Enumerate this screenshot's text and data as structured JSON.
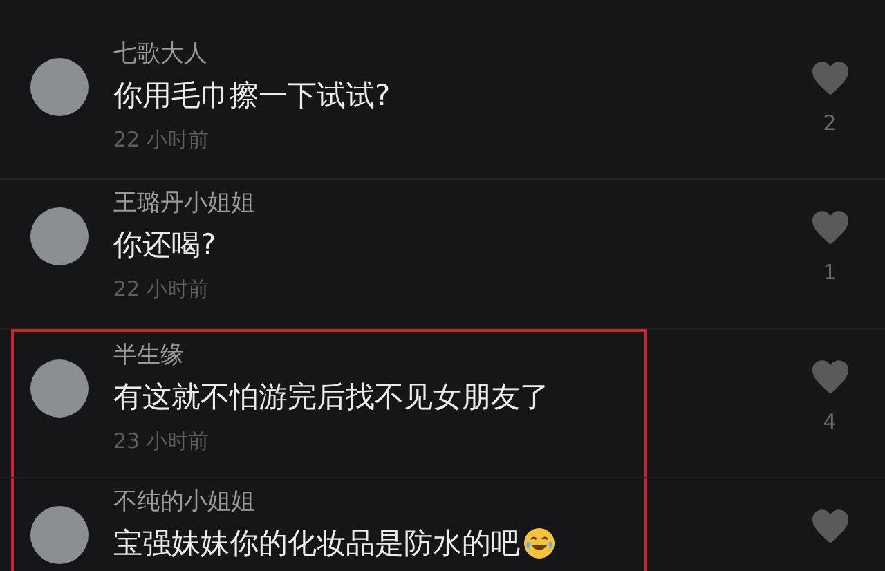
{
  "comments": [
    {
      "name": "七歌大人",
      "text": "你用毛巾擦一下试试?",
      "emoji": false,
      "time": "22 小时前",
      "likes": "2",
      "highlighted": false
    },
    {
      "name": "王璐丹小姐姐",
      "text": "你还喝?",
      "emoji": false,
      "time": "22 小时前",
      "likes": "1",
      "highlighted": false
    },
    {
      "name": "半生缘",
      "text": "有这就不怕游完后找不见女朋友了",
      "emoji": false,
      "time": "23 小时前",
      "likes": "4",
      "highlighted": true
    },
    {
      "name": "不纯的小姐姐",
      "text": "宝强妹妹你的化妆品是防水的吧",
      "emoji": true,
      "highlighted": true
    }
  ]
}
